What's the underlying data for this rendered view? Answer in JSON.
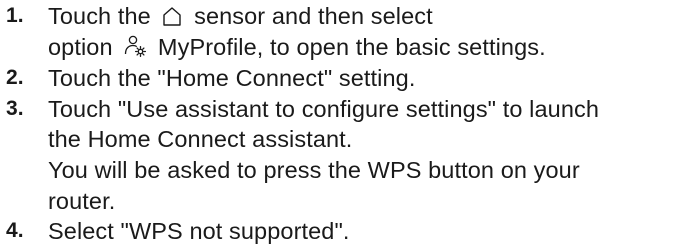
{
  "steps": [
    {
      "number": "1.",
      "line1_pre": "Touch the",
      "line1_icon": "home-icon",
      "line1_post": "sensor and then select",
      "line2_pre": "option",
      "line2_icon": "profile-settings-icon",
      "line2_post": "MyProfile, to open the basic settings."
    },
    {
      "number": "2.",
      "text": "Touch the \"Home Connect\" setting."
    },
    {
      "number": "3.",
      "line1": "Touch \"Use assistant to configure settings\" to launch",
      "line2": "the Home Connect assistant.",
      "line3": "You will be asked to press the WPS button on your",
      "line4": "router."
    },
    {
      "number": "4.",
      "text": "Select \"WPS not supported\"."
    }
  ]
}
